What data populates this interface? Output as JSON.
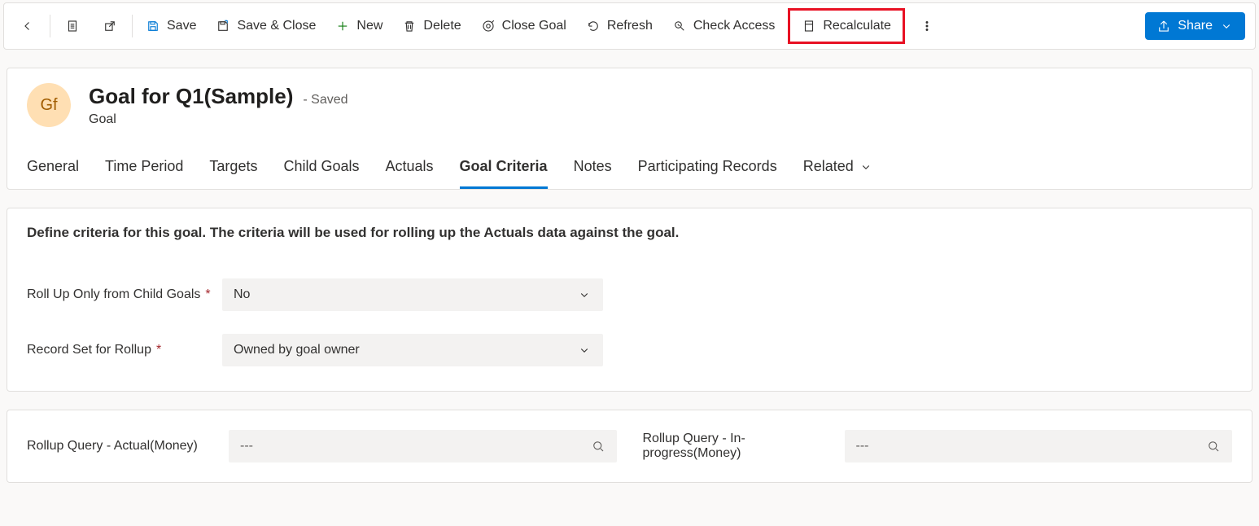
{
  "toolbar": {
    "save_label": "Save",
    "save_close_label": "Save & Close",
    "new_label": "New",
    "delete_label": "Delete",
    "close_goal_label": "Close Goal",
    "refresh_label": "Refresh",
    "check_access_label": "Check Access",
    "recalculate_label": "Recalculate",
    "share_label": "Share"
  },
  "header": {
    "avatar_initials": "Gf",
    "title": "Goal for Q1(Sample)",
    "saved_label": "- Saved",
    "entity": "Goal"
  },
  "tabs": {
    "items": [
      {
        "label": "General"
      },
      {
        "label": "Time Period"
      },
      {
        "label": "Targets"
      },
      {
        "label": "Child Goals"
      },
      {
        "label": "Actuals"
      },
      {
        "label": "Goal Criteria"
      },
      {
        "label": "Notes"
      },
      {
        "label": "Participating Records"
      },
      {
        "label": "Related"
      }
    ],
    "active_index": 5
  },
  "criteria_section": {
    "description": "Define criteria for this goal. The criteria will be used for rolling up the Actuals data against the goal.",
    "fields": {
      "roll_up_child": {
        "label": "Roll Up Only from Child Goals",
        "value": "No"
      },
      "record_set": {
        "label": "Record Set for Rollup",
        "value": "Owned by goal owner"
      }
    }
  },
  "rollup_section": {
    "actual": {
      "label": "Rollup Query - Actual(Money)",
      "value": "---"
    },
    "inprogress": {
      "label": "Rollup Query - In-progress(Money)",
      "value": "---"
    }
  }
}
